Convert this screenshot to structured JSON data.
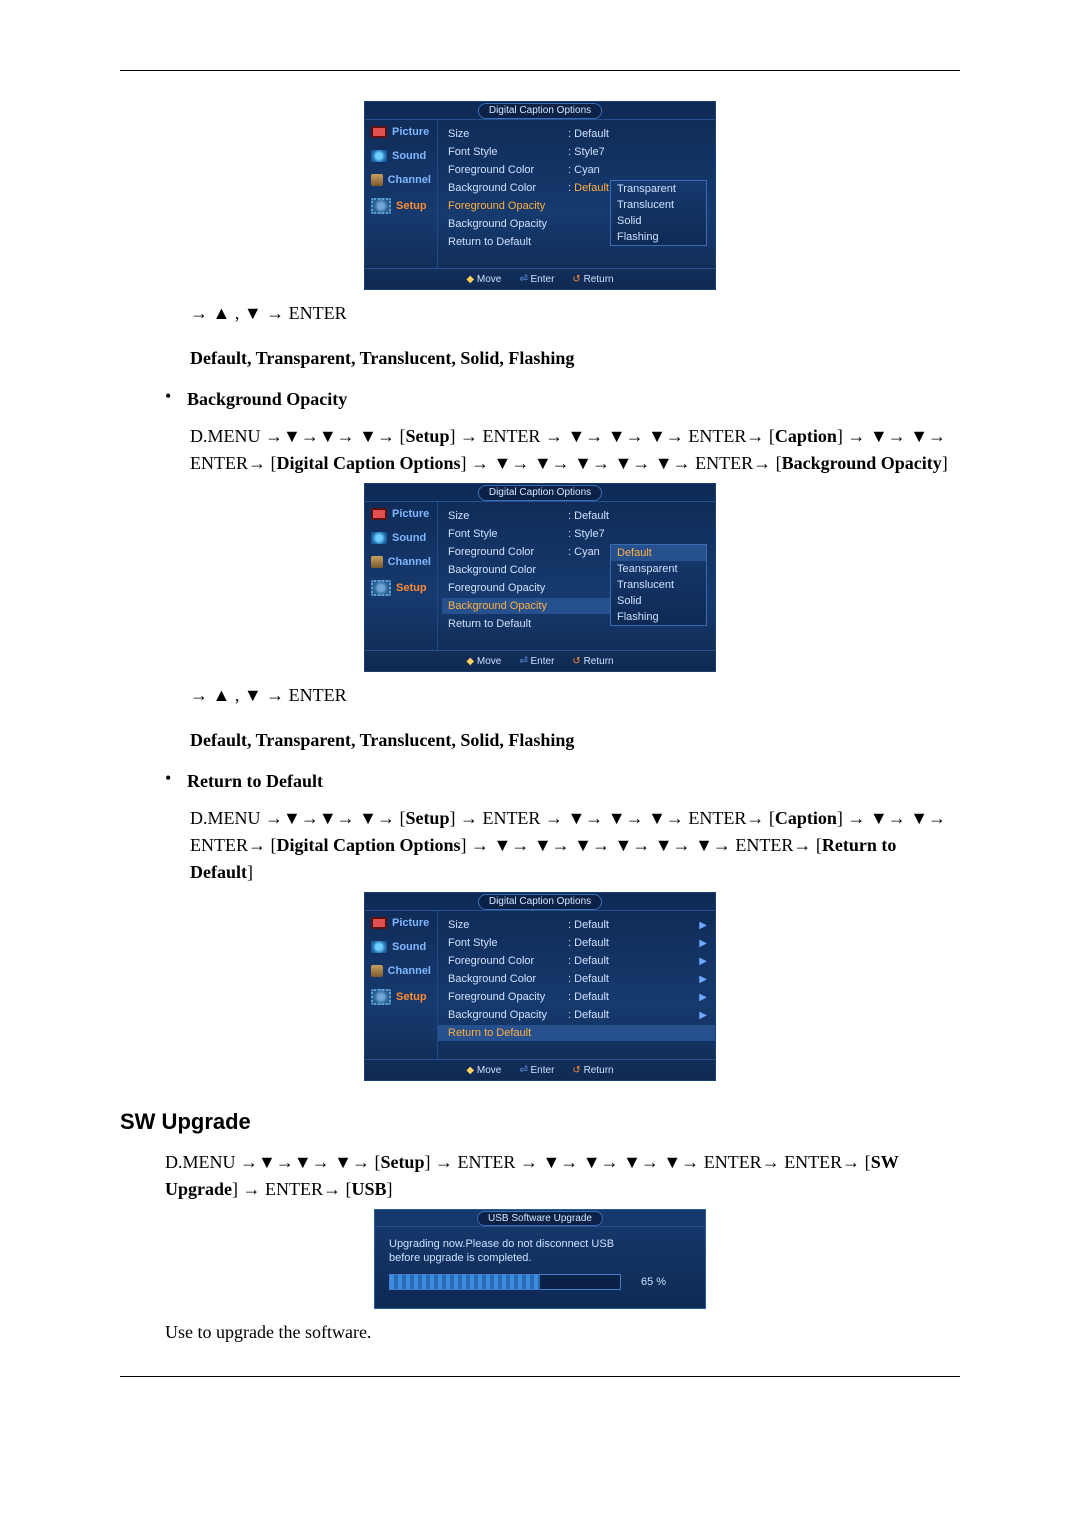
{
  "osd_title": "Digital Caption Options",
  "sidebar": {
    "picture": "Picture",
    "sound": "Sound",
    "channel": "Channel",
    "setup": "Setup"
  },
  "options": {
    "size": "Size",
    "font_style": "Font Style",
    "fg_color": "Foreground Color",
    "bg_color": "Background Color",
    "fg_opacity": "Foreground Opacity",
    "bg_opacity": "Background Opacity",
    "return": "Return to Default"
  },
  "vals1": {
    "size": "Default",
    "font_style": "Style7",
    "fg_color": "Cyan",
    "bg_color": "Default"
  },
  "dropdown_opacity": {
    "o1": "Transparent",
    "o2": "Translucent",
    "o3": "Solid",
    "o4": "Flashing"
  },
  "vals2": {
    "size": "Default",
    "font_style": "Style7",
    "fg_color": "Cyan",
    "dd_default": "Default",
    "dd_teansparent": "Teansparent",
    "dd_translucent": "Translucent",
    "dd_solid": "Solid",
    "dd_flashing": "Flashing"
  },
  "vals3": {
    "default": "Default"
  },
  "footer": {
    "move": "Move",
    "enter": "Enter",
    "return": "Return"
  },
  "line_nav": "→  ▲ , ▼  → ENTER",
  "line_opts": "Default, Transparent, Translucent, Solid, Flashing",
  "bullet_bg_opacity": "Background Opacity",
  "path_bg_opacity_a": "D.MENU →▼→▼→ ▼→ [Setup] → ENTER → ▼→ ▼→ ▼→ ENTER→ [Caption] → ▼→ ▼→ ENTER→ [Digital Caption Options] → ▼→ ▼→ ▼→ ▼→ ▼→ ENTER→ [Background Opacity]",
  "bullet_return": "Return to Default",
  "path_return": "D.MENU →▼→▼→ ▼→ [Setup] → ENTER → ▼→ ▼→ ▼→ ENTER→ [Caption] → ▼→ ▼→ ENTER→ [Digital Caption Options] → ▼→ ▼→ ▼→ ▼→ ▼→ ▼→ ENTER→ [Return to Default]",
  "h2_sw": "SW Upgrade",
  "path_sw": "D.MENU →▼→▼→ ▼→ [Setup] → ENTER → ▼→ ▼→ ▼→ ▼→ ENTER→ ENTER→ [SW Upgrade] → ENTER→ [USB]",
  "usb": {
    "title": "USB Software Upgrade",
    "msg1": "Upgrading now.Please do not disconnect USB",
    "msg2": "before upgrade is completed.",
    "pct": "65 %"
  },
  "line_use": "Use to upgrade the software."
}
